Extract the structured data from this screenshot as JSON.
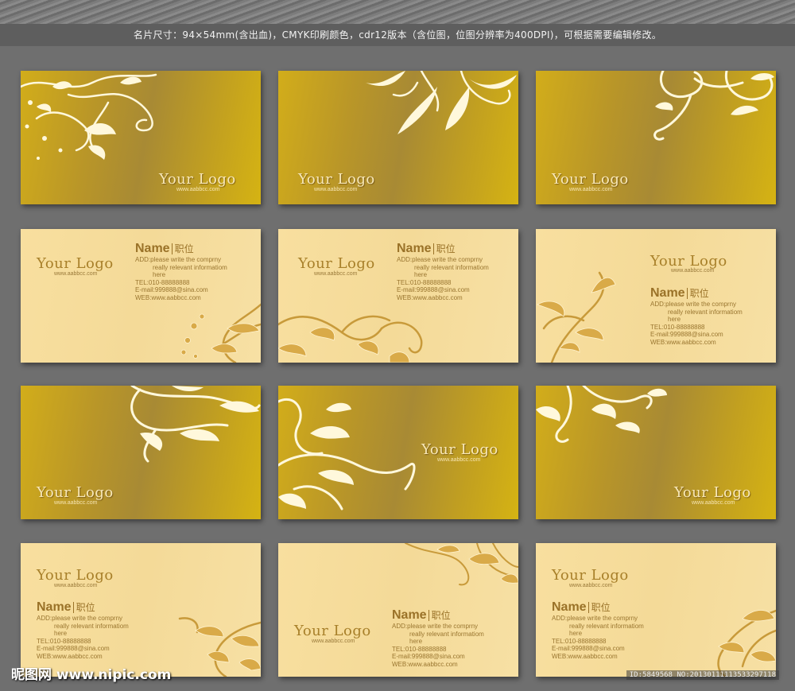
{
  "header": {
    "text": "名片尺寸：94×54mm(含出血)，CMYK印刷颜色，cdr12版本（含位图，位图分辨率为400DPI)，可根据需要编辑修改。"
  },
  "card_text": {
    "logo": "Your Logo",
    "url": "www.aabbcc.com",
    "name": "Name",
    "position": "职位",
    "add_1": "ADD:please write the comprny",
    "add_2": "really relevant informatiom",
    "add_3": "here",
    "tel": "TEL:010-88888888",
    "email": "E-mail:999888@sina.com",
    "web": "WEB:www.aabbcc.com"
  },
  "watermark": {
    "site": "昵图网 www.nipic.com",
    "id": "ID:5849568 NO:20130111113533297118"
  },
  "colors": {
    "background": "#6f6f6f",
    "gold_card": "#b99628",
    "cream_card": "#f5dc9c",
    "text_brown": "#9a7630"
  }
}
